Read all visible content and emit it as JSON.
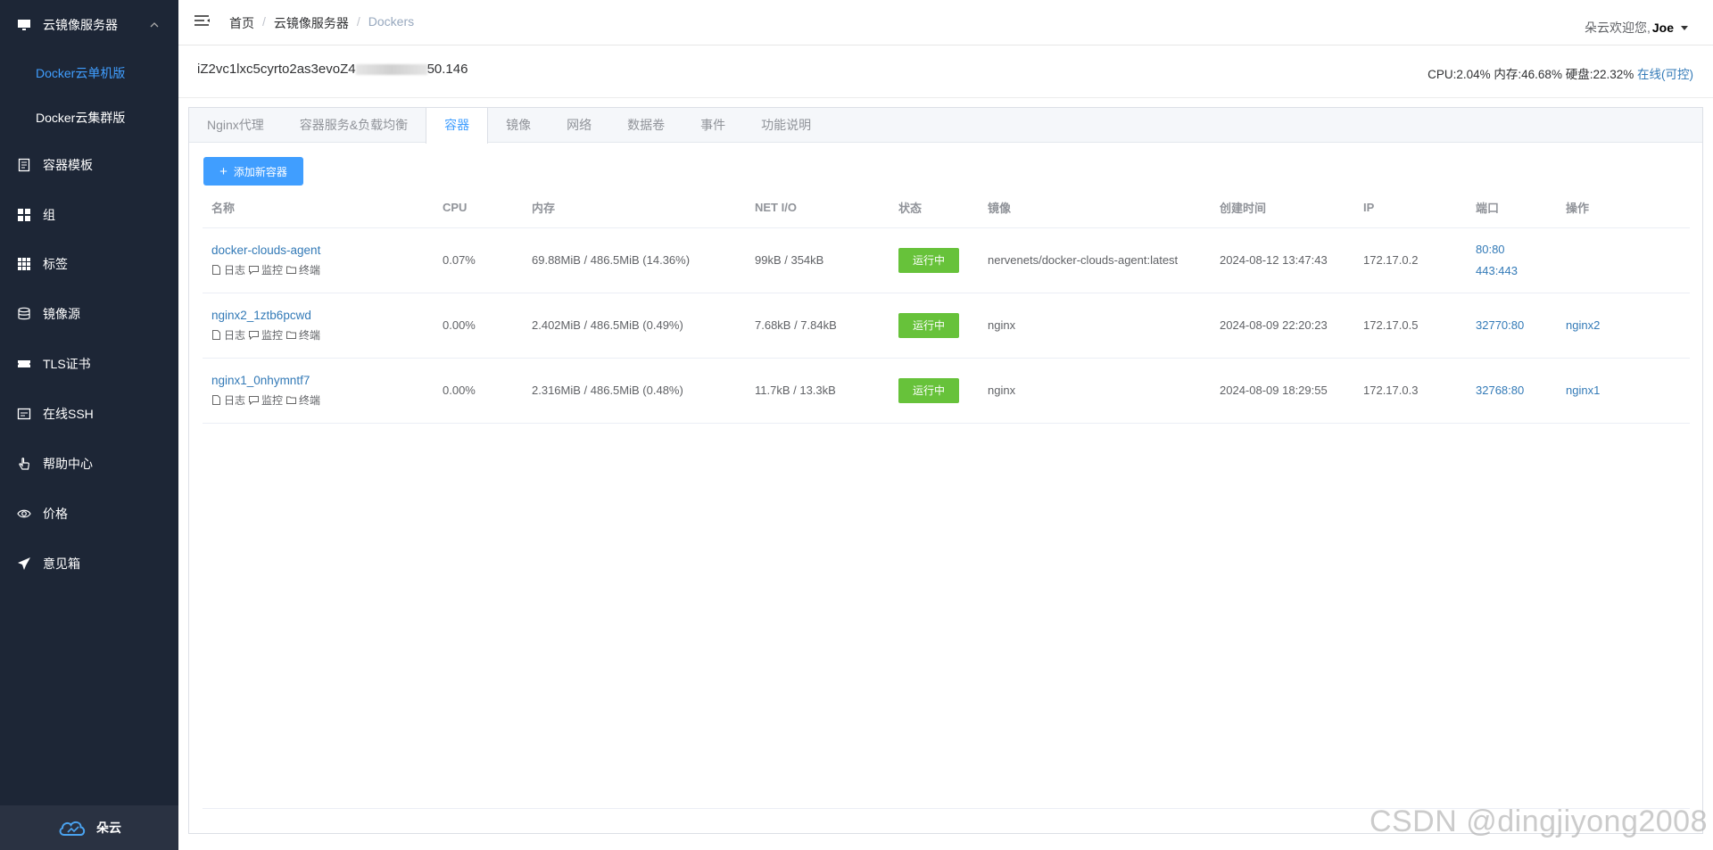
{
  "sidebar": {
    "group": {
      "label": "云镜像服务器",
      "icon": "monitor-icon"
    },
    "sub_items": [
      {
        "label": "Docker云单机版",
        "active": true
      },
      {
        "label": "Docker云集群版",
        "active": false
      }
    ],
    "items": [
      {
        "label": "容器模板",
        "icon": "document-icon"
      },
      {
        "label": "组",
        "icon": "grid-icon"
      },
      {
        "label": "标签",
        "icon": "tags-grid-icon"
      },
      {
        "label": "镜像源",
        "icon": "database-icon"
      },
      {
        "label": "TLS证书",
        "icon": "ticket-icon"
      },
      {
        "label": "在线SSH",
        "icon": "terminal-icon"
      },
      {
        "label": "帮助中心",
        "icon": "hand-pointer-icon"
      },
      {
        "label": "价格",
        "icon": "eye-icon"
      },
      {
        "label": "意见箱",
        "icon": "paper-plane-icon"
      }
    ],
    "footer": {
      "label": "朵云",
      "icon": "cloud-logo-icon"
    }
  },
  "header": {
    "breadcrumb": [
      "首页",
      "云镜像服务器",
      "Dockers"
    ],
    "welcome": "朵云欢迎您,",
    "user": "Joe"
  },
  "server": {
    "hostname_prefix": "iZ2vc1lxc5cyrto2as3evoZ4",
    "hostname_suffix": "50.146",
    "stats": "CPU:2.04% 内存:46.68% 硬盘:22.32%",
    "status_link": "在线(可控)"
  },
  "tabs": [
    {
      "label": "Nginx代理",
      "active": false
    },
    {
      "label": "容器服务&负载均衡",
      "active": false
    },
    {
      "label": "容器",
      "active": true
    },
    {
      "label": "镜像",
      "active": false
    },
    {
      "label": "网络",
      "active": false
    },
    {
      "label": "数据卷",
      "active": false
    },
    {
      "label": "事件",
      "active": false
    },
    {
      "label": "功能说明",
      "active": false
    }
  ],
  "add_button": "添加新容器",
  "table": {
    "columns": [
      "名称",
      "CPU",
      "内存",
      "NET I/O",
      "状态",
      "镜像",
      "创建时间",
      "IP",
      "端口",
      "操作"
    ],
    "action_labels": [
      "日志",
      "监控",
      "终端"
    ],
    "rows": [
      {
        "name": "docker-clouds-agent",
        "cpu": "0.07%",
        "mem": "69.88MiB / 486.5MiB (14.36%)",
        "net": "99kB / 354kB",
        "status": "运行中",
        "image": "nervenets/docker-clouds-agent:latest",
        "created": "2024-08-12 13:47:43",
        "ip": "172.17.0.2",
        "ports": [
          "80:80",
          "443:443"
        ],
        "op": ""
      },
      {
        "name": "nginx2_1ztb6pcwd",
        "cpu": "0.00%",
        "mem": "2.402MiB / 486.5MiB (0.49%)",
        "net": "7.68kB / 7.84kB",
        "status": "运行中",
        "image": "nginx",
        "created": "2024-08-09 22:20:23",
        "ip": "172.17.0.5",
        "ports": [
          "32770:80"
        ],
        "op": "nginx2"
      },
      {
        "name": "nginx1_0nhymntf7",
        "cpu": "0.00%",
        "mem": "2.316MiB / 486.5MiB (0.48%)",
        "net": "11.7kB / 13.3kB",
        "status": "运行中",
        "image": "nginx",
        "created": "2024-08-09 18:29:55",
        "ip": "172.17.0.3",
        "ports": [
          "32768:80"
        ],
        "op": "nginx1"
      }
    ]
  },
  "colors": {
    "sidebar_bg": "#1d2636",
    "accent": "#409eff",
    "link": "#337ab7",
    "status_green": "#67c23a"
  },
  "watermark": "CSDN @dingjiyong2008"
}
